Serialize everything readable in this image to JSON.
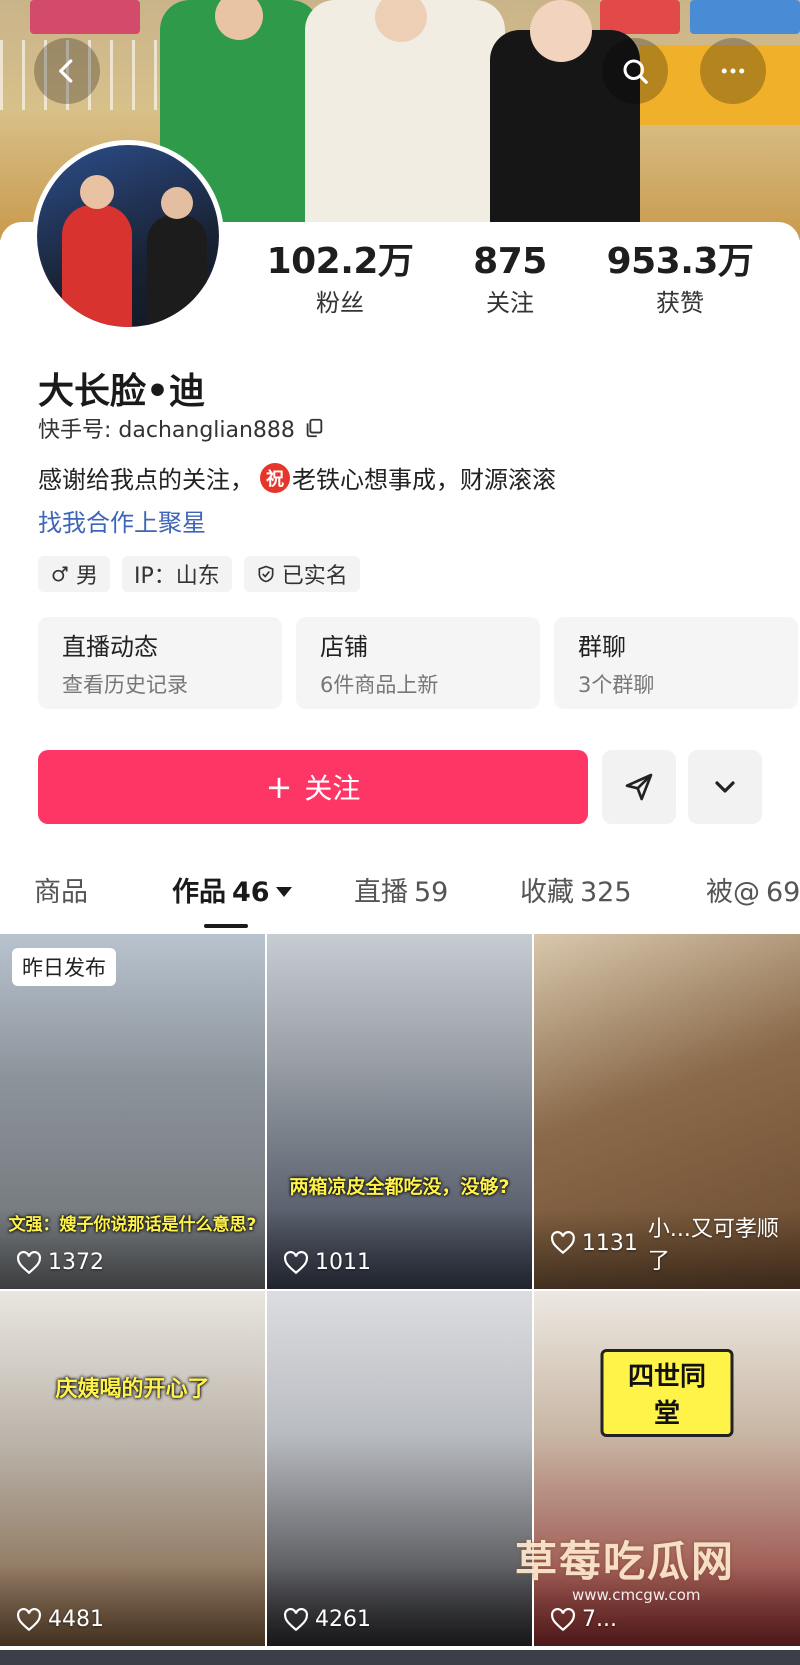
{
  "profile": {
    "stats": [
      {
        "num": "102.2万",
        "label": "粉丝"
      },
      {
        "num": "875",
        "label": "关注"
      },
      {
        "num": "953.3万",
        "label": "获赞"
      }
    ],
    "name": "大长脸•迪",
    "kuaishou_id": "快手号: dachanglian888",
    "bio_before": "感谢给我点的关注，",
    "bio_badge": "祝",
    "bio_after": "老铁心想事成，财源滚滚",
    "cooperation_link": "找我合作上聚星",
    "tags": {
      "gender": "男",
      "ip": "IP：山东",
      "verified": "已实名"
    }
  },
  "cards": [
    {
      "title": "直播动态",
      "sub": "查看历史记录"
    },
    {
      "title": "店铺",
      "sub": "6件商品上新"
    },
    {
      "title": "群聊",
      "sub": "3个群聊"
    }
  ],
  "actions": {
    "follow_plus": "+",
    "follow_label": "关注"
  },
  "tabs": [
    {
      "label": "商品",
      "count": ""
    },
    {
      "label": "作品",
      "count": "46"
    },
    {
      "label": "直播",
      "count": "59"
    },
    {
      "label": "收藏",
      "count": "325"
    },
    {
      "label": "被@",
      "count": "69"
    }
  ],
  "videos": [
    {
      "likes": "1372",
      "badge": "昨日发布",
      "caption": "文强：嫂子你说那话是什么意思?"
    },
    {
      "likes": "1011",
      "badge": "",
      "caption": "两箱凉皮全都吃没，没够?"
    },
    {
      "likes": "1131",
      "badge": "",
      "caption": "小...又可孝顺了"
    },
    {
      "likes": "4481",
      "badge": "",
      "caption": "庆姨喝的开心了"
    },
    {
      "likes": "4261",
      "badge": "",
      "caption": ""
    },
    {
      "likes": "7...",
      "badge": "",
      "caption": "四世同堂"
    }
  ],
  "watermark": {
    "text": "草莓吃瓜网",
    "url": "www.cmcgw.com"
  },
  "colors": {
    "accent": "#fe3666",
    "link": "#3e66b8",
    "badge_red": "#e6352b"
  }
}
